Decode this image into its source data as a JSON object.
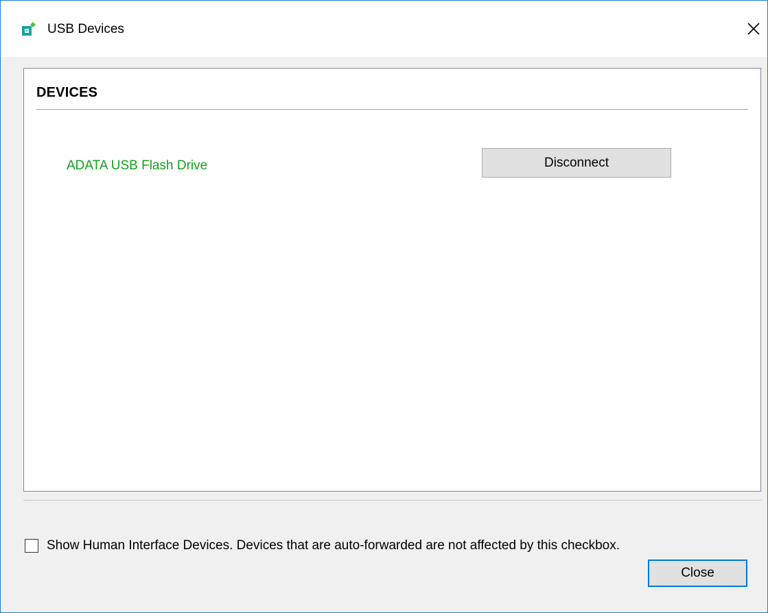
{
  "window": {
    "title": "USB Devices",
    "accent": "#0078d7"
  },
  "icons": {
    "app": "usb-devices-app-icon",
    "close": "close-icon"
  },
  "devices_section": {
    "heading": "DEVICES",
    "devices": [
      {
        "name": "ADATA USB Flash Drive",
        "name_color": "#14a01e",
        "action_label": "Disconnect"
      }
    ]
  },
  "footer": {
    "hid_checkbox": {
      "checked": false,
      "label": "Show Human Interface Devices. Devices that are auto-forwarded are not affected by this checkbox."
    },
    "close_label": "Close"
  }
}
